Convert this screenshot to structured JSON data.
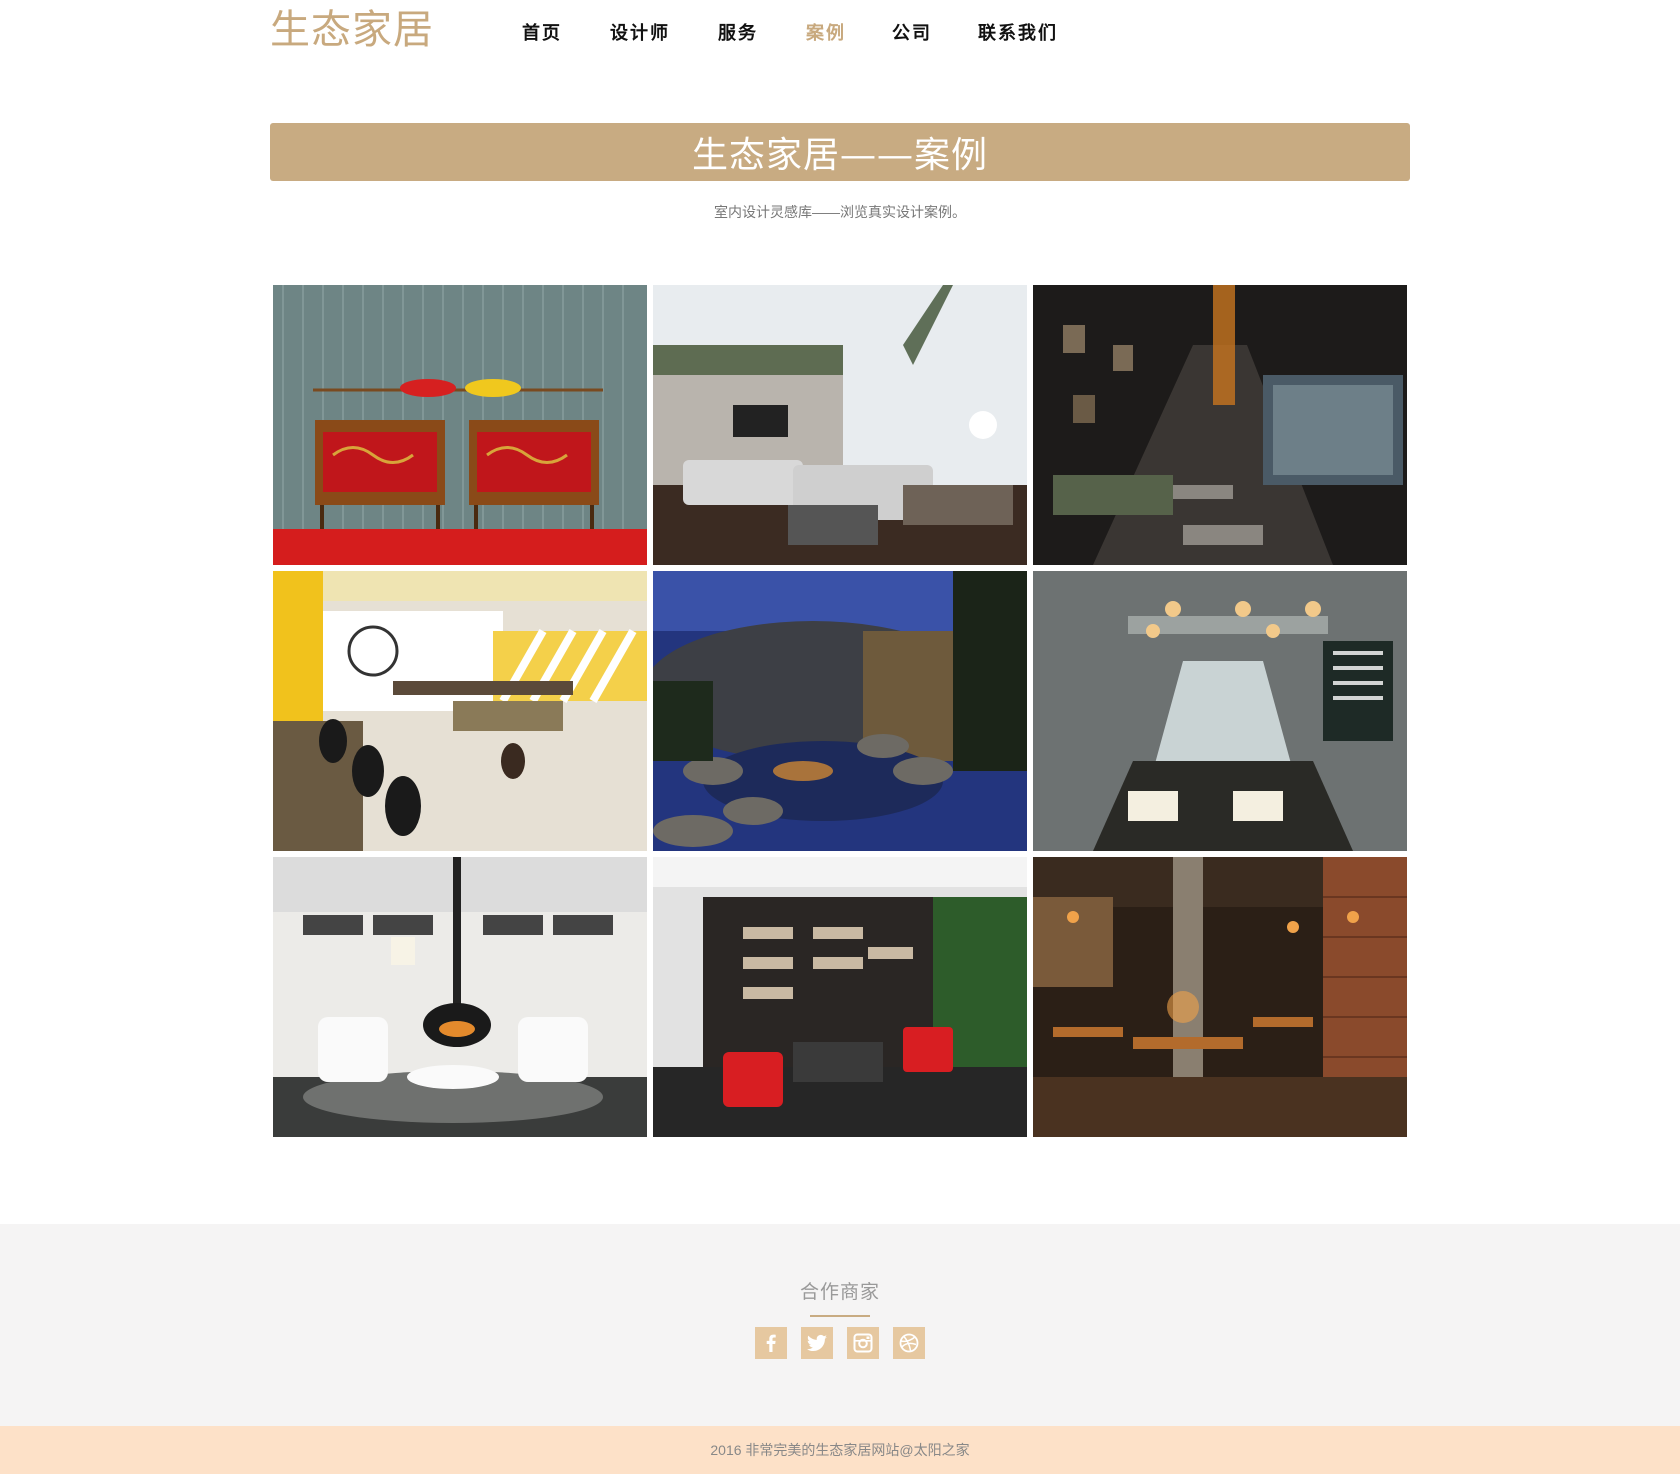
{
  "brand": {
    "logo": "生态家居"
  },
  "nav": {
    "items": [
      {
        "label": "首页",
        "active": false
      },
      {
        "label": "设计师",
        "active": false
      },
      {
        "label": "服务",
        "active": false
      },
      {
        "label": "案例",
        "active": true
      },
      {
        "label": "公司",
        "active": false
      },
      {
        "label": "联系我们",
        "active": false
      }
    ]
  },
  "page": {
    "title": "生态家居——案例",
    "subtitle": "室内设计灵感库——浏览真实设计案例。"
  },
  "gallery": {
    "items": [
      {
        "scene": "red-cabinets-paddles"
      },
      {
        "scene": "white-living-room"
      },
      {
        "scene": "dark-corridor-pond"
      },
      {
        "scene": "yellow-cafe"
      },
      {
        "scene": "night-garden-pond"
      },
      {
        "scene": "dining-room-pendants"
      },
      {
        "scene": "fireplace-lounge"
      },
      {
        "scene": "bookstore-red-chairs"
      },
      {
        "scene": "restaurant-brick"
      }
    ]
  },
  "footer": {
    "partners_title": "合作商家",
    "socials": [
      {
        "icon": "facebook-icon"
      },
      {
        "icon": "twitter-icon"
      },
      {
        "icon": "instagram-icon"
      },
      {
        "icon": "dribbble-icon"
      }
    ],
    "copyright": "2016 非常完美的生态家居网站@太阳之家"
  },
  "colors": {
    "accent": "#c8ab82",
    "footer_bg": "#f5f4f4",
    "copyright_bg": "#fde1c8"
  }
}
